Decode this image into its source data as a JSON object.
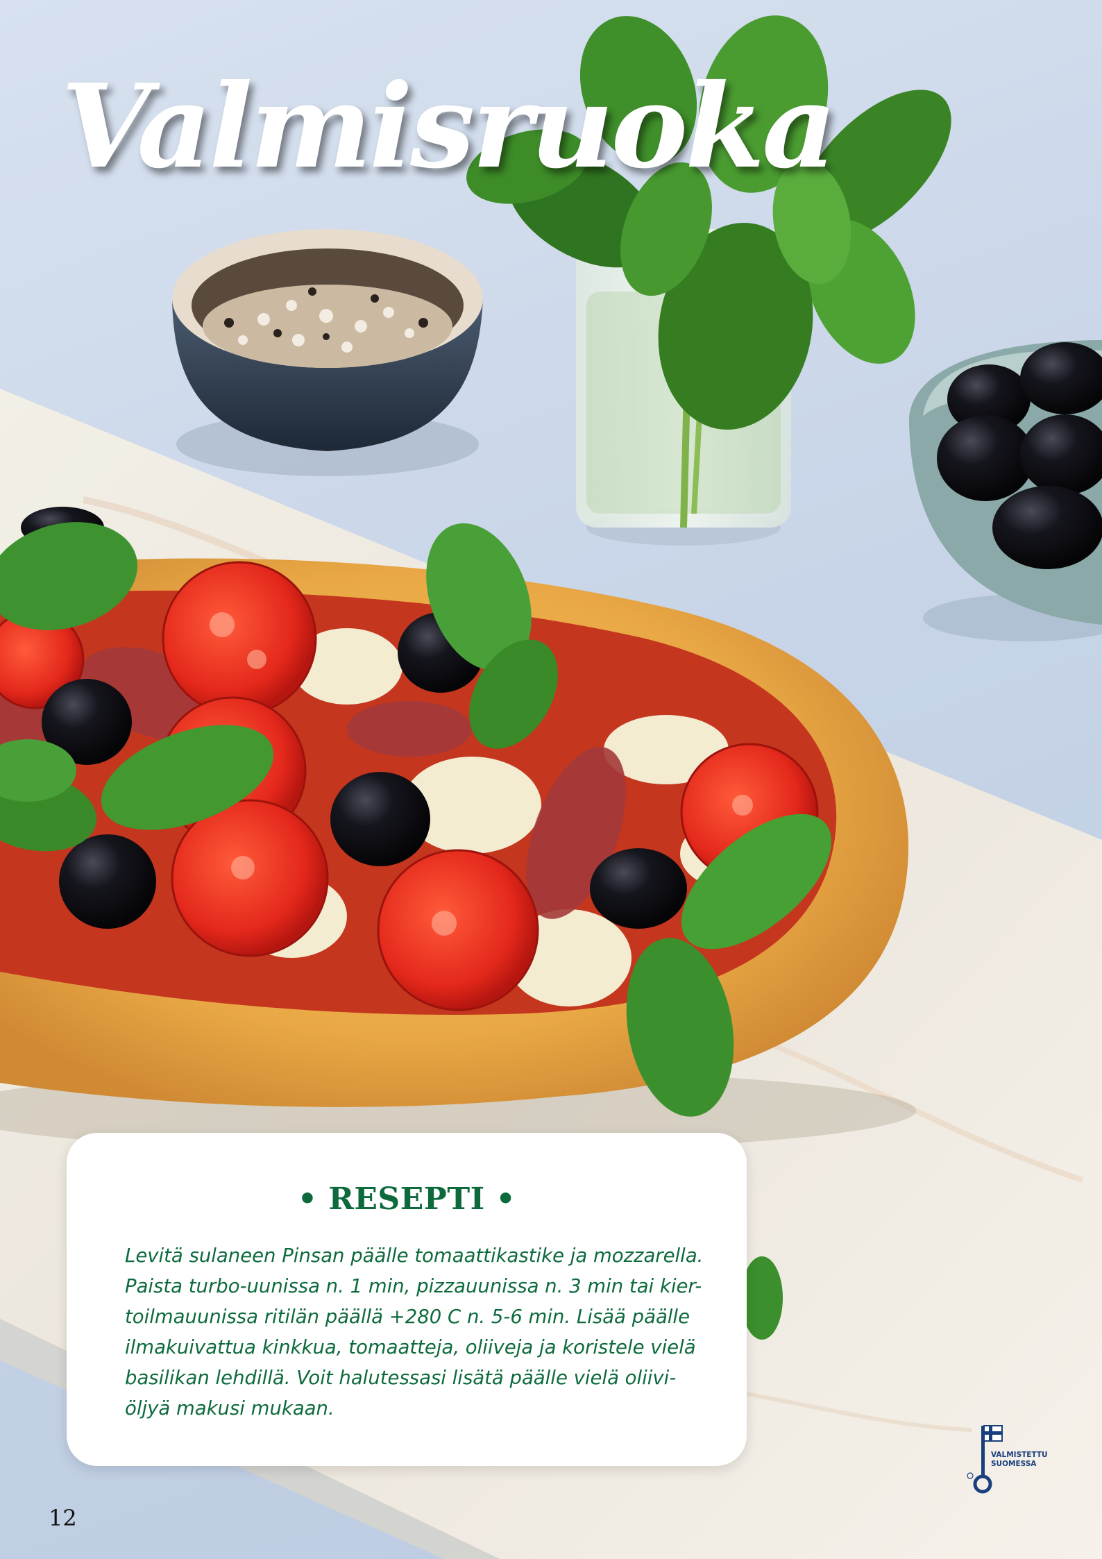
{
  "page": {
    "title": "Valmisruoka",
    "page_number": "12"
  },
  "recipe": {
    "heading": "• RESEPTI •",
    "lines": [
      "Levitä sulaneen Pinsan päälle tomaattikastike ja mozzarella.",
      "Paista turbo-uunissa n. 1 min, pizzauunissa n. 3 min tai kier-",
      "toilmauunissa ritilän päällä +280 C n. 5-6 min. Lisää päälle",
      "ilmakuivattua kinkkua, tomaatteja, oliiveja ja koristele vielä",
      "basilikan lehdillä. Voit halutessasi lisätä päälle vielä oliivi-",
      "öljyä makusi mukaan."
    ]
  },
  "badge": {
    "line1": "VALMISTETTU",
    "line2": "SUOMESSA",
    "icon": "key-flag-icon"
  },
  "colors": {
    "accent_green": "#0d6a3c",
    "badge_blue": "#1a3f7d"
  }
}
